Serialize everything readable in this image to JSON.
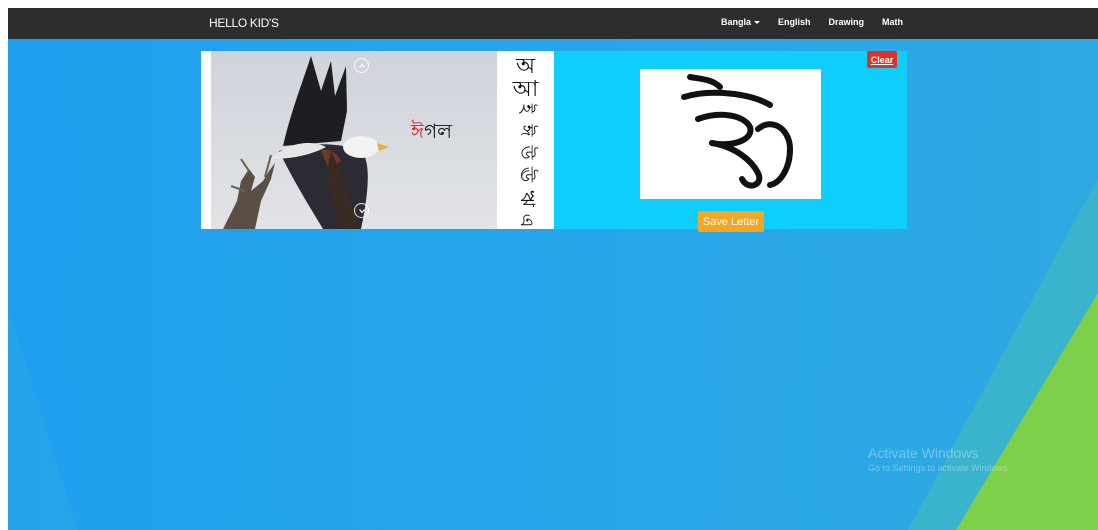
{
  "navbar": {
    "brand": "HELLO KID'S",
    "links": [
      {
        "label": "Bangla",
        "dropdown": true
      },
      {
        "label": "English"
      },
      {
        "label": "Drawing"
      },
      {
        "label": "Math"
      }
    ]
  },
  "panel": {
    "word_first_letter": "ঈ",
    "word_rest": "গল",
    "letters": [
      "অ",
      "আ",
      "ই",
      "ঈ",
      "উ",
      "ঊ",
      "ঋ",
      "এ"
    ],
    "canvas_letter": "ঈ",
    "save_label": "Save Letter",
    "clear_label": "Clear"
  },
  "watermark": {
    "title": "Activate Windows",
    "subtitle": "Go to Settings to activate Windows."
  },
  "colors": {
    "navbar": "#2d2d2d",
    "background": "#2aa8e4",
    "panel": "#0fcdfc",
    "save_button": "#f5a623",
    "clear_button": "#d9332b",
    "accent_green": "#7ed04a"
  },
  "icons": [
    "chevron-up-icon",
    "chevron-down-icon",
    "eagle-photo"
  ]
}
